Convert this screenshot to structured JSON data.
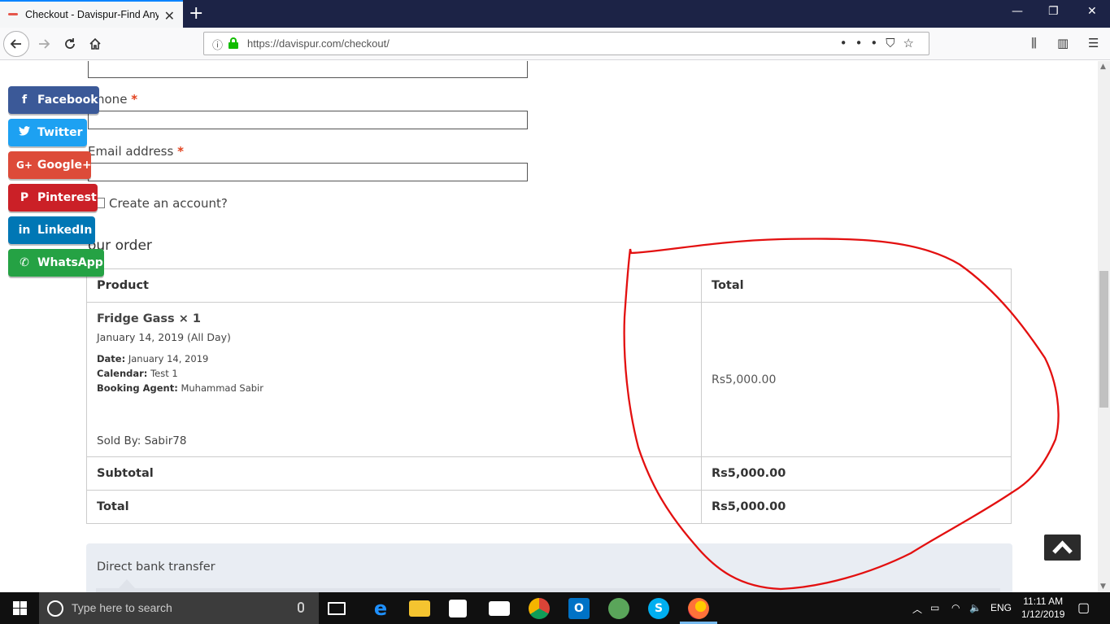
{
  "browser": {
    "tab_title": "Checkout - Davispur-Find Any",
    "tab_close": "✕",
    "new_tab": "+",
    "url": "https://davispur.com/checkout/",
    "window_controls": {
      "minimize": "—",
      "restore": "❐",
      "close": "✕"
    }
  },
  "form": {
    "phone_label": "hone",
    "email_label": "Email address",
    "required_mark": "*",
    "create_account": "Create an account?"
  },
  "order": {
    "heading": "our order",
    "col_product": "Product",
    "col_total": "Total",
    "item": {
      "name": "Fridge Gass × 1",
      "date_line": "January 14, 2019 (All Day)",
      "date_key": "Date:",
      "date_val": "January 14, 2019",
      "calendar_key": "Calendar:",
      "calendar_val": "Test 1",
      "agent_key": "Booking Agent:",
      "agent_val": "Muhammad Sabir",
      "sold_by": "Sold By:",
      "seller": "Sabir78",
      "price": "Rs5,000.00"
    },
    "subtotal_label": "Subtotal",
    "subtotal_value": "Rs5,000.00",
    "total_label": "Total",
    "total_value": "Rs5,000.00"
  },
  "payment": {
    "method": "Direct bank transfer"
  },
  "social": [
    {
      "label": "Facebook",
      "icon": "f",
      "color": "#3b5998"
    },
    {
      "label": "Twitter",
      "icon": "🐦",
      "color": "#1da1f2"
    },
    {
      "label": "Google+",
      "icon": "G+",
      "color": "#dd4b39"
    },
    {
      "label": "Pinterest",
      "icon": "P",
      "color": "#cb2027"
    },
    {
      "label": "LinkedIn",
      "icon": "in",
      "color": "#0077b5"
    },
    {
      "label": "WhatsApp",
      "icon": "✆",
      "color": "#25a244"
    }
  ],
  "taskbar": {
    "search_placeholder": "Type here to search",
    "language": "ENG",
    "time": "11:11 AM",
    "date": "1/12/2019"
  }
}
